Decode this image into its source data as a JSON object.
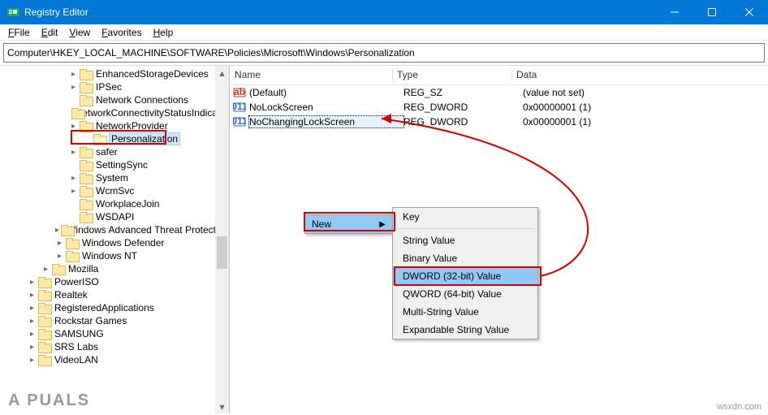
{
  "window": {
    "title": "Registry Editor"
  },
  "menu": {
    "file": "File",
    "edit": "Edit",
    "view": "View",
    "favorites": "Favorites",
    "help": "Help"
  },
  "address": "Computer\\HKEY_LOCAL_MACHINE\\SOFTWARE\\Policies\\Microsoft\\Windows\\Personalization",
  "tree": {
    "items": [
      {
        "level": "lv3b",
        "exp": ">",
        "label": "EnhancedStorageDevices"
      },
      {
        "level": "lv3b",
        "exp": ">",
        "label": "IPSec"
      },
      {
        "level": "lv3b",
        "exp": "",
        "label": "Network Connections"
      },
      {
        "level": "lv3b",
        "exp": "",
        "label": "NetworkConnectivityStatusIndicator"
      },
      {
        "level": "lv3b",
        "exp": ">",
        "label": "NetworkProvider"
      },
      {
        "level": "lv4",
        "exp": "",
        "label": "Personalization",
        "hl": true
      },
      {
        "level": "lv3b",
        "exp": ">",
        "label": "safer"
      },
      {
        "level": "lv3b",
        "exp": "",
        "label": "SettingSync"
      },
      {
        "level": "lv3b",
        "exp": ">",
        "label": "System"
      },
      {
        "level": "lv3b",
        "exp": ">",
        "label": "WcmSvc"
      },
      {
        "level": "lv3b",
        "exp": "",
        "label": "WorkplaceJoin"
      },
      {
        "level": "lv3b",
        "exp": "",
        "label": "WSDAPI"
      },
      {
        "level": "lv3",
        "exp": ">",
        "label": "Windows Advanced Threat Protection"
      },
      {
        "level": "lv3",
        "exp": ">",
        "label": "Windows Defender"
      },
      {
        "level": "lv3",
        "exp": ">",
        "label": "Windows NT"
      },
      {
        "level": "lv2",
        "exp": ">",
        "label": "Mozilla"
      },
      {
        "level": "lv1",
        "exp": ">",
        "label": "PowerISO"
      },
      {
        "level": "lv1",
        "exp": ">",
        "label": "Realtek"
      },
      {
        "level": "lv1",
        "exp": ">",
        "label": "RegisteredApplications"
      },
      {
        "level": "lv1",
        "exp": ">",
        "label": "Rockstar Games"
      },
      {
        "level": "lv1",
        "exp": ">",
        "label": "SAMSUNG"
      },
      {
        "level": "lv1",
        "exp": ">",
        "label": "SRS Labs"
      },
      {
        "level": "lv1",
        "exp": ">",
        "label": "VideoLAN"
      }
    ]
  },
  "list": {
    "cols": {
      "name": "Name",
      "type": "Type",
      "data": "Data"
    },
    "rows": [
      {
        "icon": "ab",
        "name": "(Default)",
        "type": "REG_SZ",
        "data": "(value not set)"
      },
      {
        "icon": "bin",
        "name": "NoLockScreen",
        "type": "REG_DWORD",
        "data": "0x00000001 (1)"
      },
      {
        "icon": "bin",
        "name": "NoChangingLockScreen",
        "type": "REG_DWORD",
        "data": "0x00000001 (1)",
        "sel": true
      }
    ]
  },
  "context": {
    "new": "New",
    "fly": {
      "key": "Key",
      "string": "String Value",
      "binary": "Binary Value",
      "dword": "DWORD (32-bit) Value",
      "qword": "QWORD (64-bit) Value",
      "multi": "Multi-String Value",
      "expand": "Expandable String Value"
    }
  },
  "marks": {
    "watermark": "A PUALS",
    "source": "wsxdn.com"
  }
}
